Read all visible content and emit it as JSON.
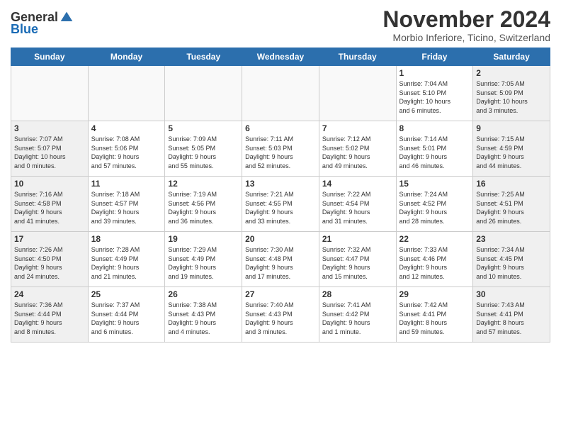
{
  "logo": {
    "general": "General",
    "blue": "Blue"
  },
  "title": "November 2024",
  "subtitle": "Morbio Inferiore, Ticino, Switzerland",
  "headers": [
    "Sunday",
    "Monday",
    "Tuesday",
    "Wednesday",
    "Thursday",
    "Friday",
    "Saturday"
  ],
  "weeks": [
    [
      {
        "day": "",
        "info": ""
      },
      {
        "day": "",
        "info": ""
      },
      {
        "day": "",
        "info": ""
      },
      {
        "day": "",
        "info": ""
      },
      {
        "day": "",
        "info": ""
      },
      {
        "day": "1",
        "info": "Sunrise: 7:04 AM\nSunset: 5:10 PM\nDaylight: 10 hours\nand 6 minutes."
      },
      {
        "day": "2",
        "info": "Sunrise: 7:05 AM\nSunset: 5:09 PM\nDaylight: 10 hours\nand 3 minutes."
      }
    ],
    [
      {
        "day": "3",
        "info": "Sunrise: 7:07 AM\nSunset: 5:07 PM\nDaylight: 10 hours\nand 0 minutes."
      },
      {
        "day": "4",
        "info": "Sunrise: 7:08 AM\nSunset: 5:06 PM\nDaylight: 9 hours\nand 57 minutes."
      },
      {
        "day": "5",
        "info": "Sunrise: 7:09 AM\nSunset: 5:05 PM\nDaylight: 9 hours\nand 55 minutes."
      },
      {
        "day": "6",
        "info": "Sunrise: 7:11 AM\nSunset: 5:03 PM\nDaylight: 9 hours\nand 52 minutes."
      },
      {
        "day": "7",
        "info": "Sunrise: 7:12 AM\nSunset: 5:02 PM\nDaylight: 9 hours\nand 49 minutes."
      },
      {
        "day": "8",
        "info": "Sunrise: 7:14 AM\nSunset: 5:01 PM\nDaylight: 9 hours\nand 46 minutes."
      },
      {
        "day": "9",
        "info": "Sunrise: 7:15 AM\nSunset: 4:59 PM\nDaylight: 9 hours\nand 44 minutes."
      }
    ],
    [
      {
        "day": "10",
        "info": "Sunrise: 7:16 AM\nSunset: 4:58 PM\nDaylight: 9 hours\nand 41 minutes."
      },
      {
        "day": "11",
        "info": "Sunrise: 7:18 AM\nSunset: 4:57 PM\nDaylight: 9 hours\nand 39 minutes."
      },
      {
        "day": "12",
        "info": "Sunrise: 7:19 AM\nSunset: 4:56 PM\nDaylight: 9 hours\nand 36 minutes."
      },
      {
        "day": "13",
        "info": "Sunrise: 7:21 AM\nSunset: 4:55 PM\nDaylight: 9 hours\nand 33 minutes."
      },
      {
        "day": "14",
        "info": "Sunrise: 7:22 AM\nSunset: 4:54 PM\nDaylight: 9 hours\nand 31 minutes."
      },
      {
        "day": "15",
        "info": "Sunrise: 7:24 AM\nSunset: 4:52 PM\nDaylight: 9 hours\nand 28 minutes."
      },
      {
        "day": "16",
        "info": "Sunrise: 7:25 AM\nSunset: 4:51 PM\nDaylight: 9 hours\nand 26 minutes."
      }
    ],
    [
      {
        "day": "17",
        "info": "Sunrise: 7:26 AM\nSunset: 4:50 PM\nDaylight: 9 hours\nand 24 minutes."
      },
      {
        "day": "18",
        "info": "Sunrise: 7:28 AM\nSunset: 4:49 PM\nDaylight: 9 hours\nand 21 minutes."
      },
      {
        "day": "19",
        "info": "Sunrise: 7:29 AM\nSunset: 4:49 PM\nDaylight: 9 hours\nand 19 minutes."
      },
      {
        "day": "20",
        "info": "Sunrise: 7:30 AM\nSunset: 4:48 PM\nDaylight: 9 hours\nand 17 minutes."
      },
      {
        "day": "21",
        "info": "Sunrise: 7:32 AM\nSunset: 4:47 PM\nDaylight: 9 hours\nand 15 minutes."
      },
      {
        "day": "22",
        "info": "Sunrise: 7:33 AM\nSunset: 4:46 PM\nDaylight: 9 hours\nand 12 minutes."
      },
      {
        "day": "23",
        "info": "Sunrise: 7:34 AM\nSunset: 4:45 PM\nDaylight: 9 hours\nand 10 minutes."
      }
    ],
    [
      {
        "day": "24",
        "info": "Sunrise: 7:36 AM\nSunset: 4:44 PM\nDaylight: 9 hours\nand 8 minutes."
      },
      {
        "day": "25",
        "info": "Sunrise: 7:37 AM\nSunset: 4:44 PM\nDaylight: 9 hours\nand 6 minutes."
      },
      {
        "day": "26",
        "info": "Sunrise: 7:38 AM\nSunset: 4:43 PM\nDaylight: 9 hours\nand 4 minutes."
      },
      {
        "day": "27",
        "info": "Sunrise: 7:40 AM\nSunset: 4:43 PM\nDaylight: 9 hours\nand 3 minutes."
      },
      {
        "day": "28",
        "info": "Sunrise: 7:41 AM\nSunset: 4:42 PM\nDaylight: 9 hours\nand 1 minute."
      },
      {
        "day": "29",
        "info": "Sunrise: 7:42 AM\nSunset: 4:41 PM\nDaylight: 8 hours\nand 59 minutes."
      },
      {
        "day": "30",
        "info": "Sunrise: 7:43 AM\nSunset: 4:41 PM\nDaylight: 8 hours\nand 57 minutes."
      }
    ]
  ]
}
